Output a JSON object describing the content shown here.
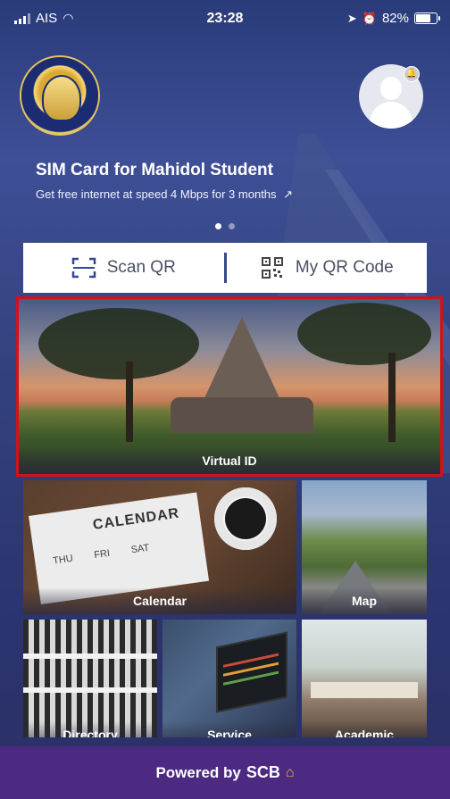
{
  "status_bar": {
    "carrier": "AIS",
    "time": "23:28",
    "battery": "82%",
    "battery_level": 0.82
  },
  "banner": {
    "title": "SIM Card for Mahidol Student",
    "subtitle": "Get free internet at speed 4 Mbps for 3 months",
    "dots": 2,
    "active_dot": 0
  },
  "actions": {
    "scan_qr": "Scan QR",
    "my_qr": "My QR Code"
  },
  "tiles": {
    "virtual_id": "Virtual ID",
    "calendar": "Calendar",
    "calendar_image_title": "CALENDAR",
    "calendar_days": [
      "THU",
      "FRI",
      "SAT"
    ],
    "map": "Map",
    "directory": "Directory",
    "service": "Service",
    "academic": "Academic"
  },
  "footer": {
    "powered_by": "Powered by",
    "brand": "SCB"
  },
  "colors": {
    "footer_bg": "#4c2a82",
    "highlight_border": "#d0121a",
    "divider": "#35478f",
    "scb_accent": "#f2b632"
  }
}
